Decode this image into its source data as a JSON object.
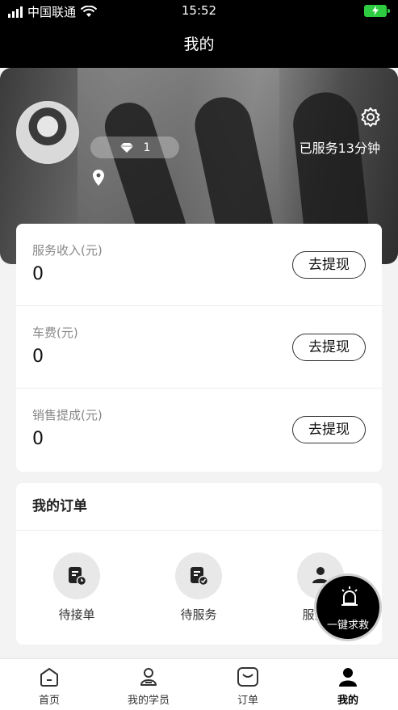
{
  "status_bar": {
    "carrier": "中国联通",
    "time": "15:52"
  },
  "header": {
    "title": "我的"
  },
  "profile": {
    "level_count": "1",
    "served_text": "已服务13分钟"
  },
  "income": {
    "rows": [
      {
        "label": "服务收入(元)",
        "value": "0",
        "button": "去提现"
      },
      {
        "label": "车费(元)",
        "value": "0",
        "button": "去提现"
      },
      {
        "label": "销售提成(元)",
        "value": "0",
        "button": "去提现"
      }
    ]
  },
  "orders": {
    "title": "我的订单",
    "items": [
      {
        "label": "待接单",
        "icon": "pending-order-icon"
      },
      {
        "label": "待服务",
        "icon": "to-serve-icon"
      },
      {
        "label": "服务中",
        "icon": "in-service-icon"
      }
    ]
  },
  "sos": {
    "label": "一键求救"
  },
  "tabs": [
    {
      "label": "首页",
      "icon": "home-icon"
    },
    {
      "label": "我的学员",
      "icon": "students-icon"
    },
    {
      "label": "订单",
      "icon": "order-icon"
    },
    {
      "label": "我的",
      "icon": "person-icon",
      "active": true
    }
  ]
}
